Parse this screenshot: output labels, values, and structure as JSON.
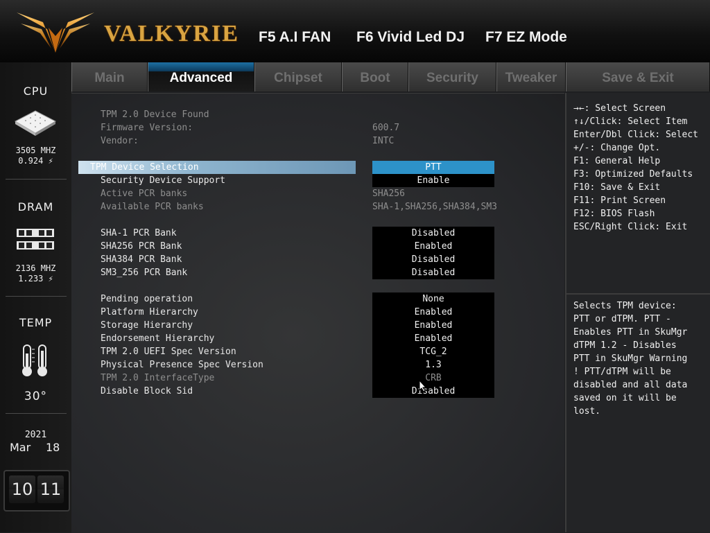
{
  "header": {
    "brand": "VALKYRIE",
    "hotkeys": [
      {
        "label": "F5 A.I FAN"
      },
      {
        "label": "F6 Vivid Led DJ"
      },
      {
        "label": "F7 EZ Mode"
      }
    ]
  },
  "sidebar": {
    "cpu": {
      "title": "CPU",
      "freq": "3505 MHZ",
      "volt": "0.924"
    },
    "dram": {
      "title": "DRAM",
      "freq": "2136 MHZ",
      "volt": "1.233"
    },
    "temp": {
      "title": "TEMP",
      "value": "30°"
    },
    "date": {
      "year": "2021",
      "month": "Mar",
      "day": "18"
    },
    "clock": {
      "hour": "10",
      "minute": "11"
    }
  },
  "tabs": [
    {
      "label": "Main",
      "active": false
    },
    {
      "label": "Advanced",
      "active": true
    },
    {
      "label": "Chipset",
      "active": false
    },
    {
      "label": "Boot",
      "active": false
    },
    {
      "label": "Security",
      "active": false
    },
    {
      "label": "Tweaker",
      "active": false
    },
    {
      "label": "Save & Exit",
      "active": false
    }
  ],
  "settings": [
    {
      "label": "TPM 2.0 Device Found",
      "value": "",
      "style": "plain",
      "dim": true
    },
    {
      "label": "Firmware Version:",
      "value": "600.7",
      "style": "plain",
      "dim": true
    },
    {
      "label": "Vendor:",
      "value": "INTC",
      "style": "plain",
      "dim": true
    },
    {
      "label": "TPM Device Selection",
      "value": "PTT",
      "style": "box",
      "selected": true
    },
    {
      "label": "Security Device Support",
      "value": "Enable",
      "style": "box"
    },
    {
      "label": "Active PCR banks",
      "value": "SHA256",
      "style": "plain",
      "dim": true
    },
    {
      "label": "Available PCR banks",
      "value": "SHA-1,SHA256,SHA384,SM3",
      "style": "plain",
      "dim": true
    },
    {
      "label": "SHA-1 PCR Bank",
      "value": "Disabled",
      "style": "box"
    },
    {
      "label": "SHA256 PCR Bank",
      "value": "Enabled",
      "style": "box"
    },
    {
      "label": "SHA384 PCR Bank",
      "value": "Disabled",
      "style": "box"
    },
    {
      "label": "SM3_256 PCR Bank",
      "value": "Disabled",
      "style": "box"
    },
    {
      "label": "Pending operation",
      "value": "None",
      "style": "box"
    },
    {
      "label": "Platform Hierarchy",
      "value": "Enabled",
      "style": "box"
    },
    {
      "label": "Storage Hierarchy",
      "value": "Enabled",
      "style": "box"
    },
    {
      "label": "Endorsement Hierarchy",
      "value": "Enabled",
      "style": "box"
    },
    {
      "label": "TPM 2.0 UEFI Spec Version",
      "value": "TCG_2",
      "style": "box"
    },
    {
      "label": "Physical Presence Spec Version",
      "value": "1.3",
      "style": "box"
    },
    {
      "label": "TPM 2.0 InterfaceType",
      "value": "CRB",
      "style": "box",
      "dim": true
    },
    {
      "label": "Disable Block Sid",
      "value": "Disabled",
      "style": "box"
    }
  ],
  "help": {
    "keys": [
      "→←: Select Screen",
      "↑↓/Click: Select Item",
      "Enter/Dbl Click: Select",
      "+/-: Change Opt.",
      "F1: General Help",
      "F3: Optimized Defaults",
      "F10: Save & Exit",
      "F11: Print Screen",
      "F12: BIOS Flash",
      "ESC/Right Click: Exit"
    ],
    "description": [
      "Selects TPM device:",
      "PTT or dTPM. PTT -",
      "Enables PTT in SkuMgr",
      "dTPM 1.2 - Disables",
      "PTT in SkuMgr Warning",
      "!  PTT/dTPM will be",
      "disabled and all data",
      "saved on it will be",
      "lost."
    ]
  }
}
